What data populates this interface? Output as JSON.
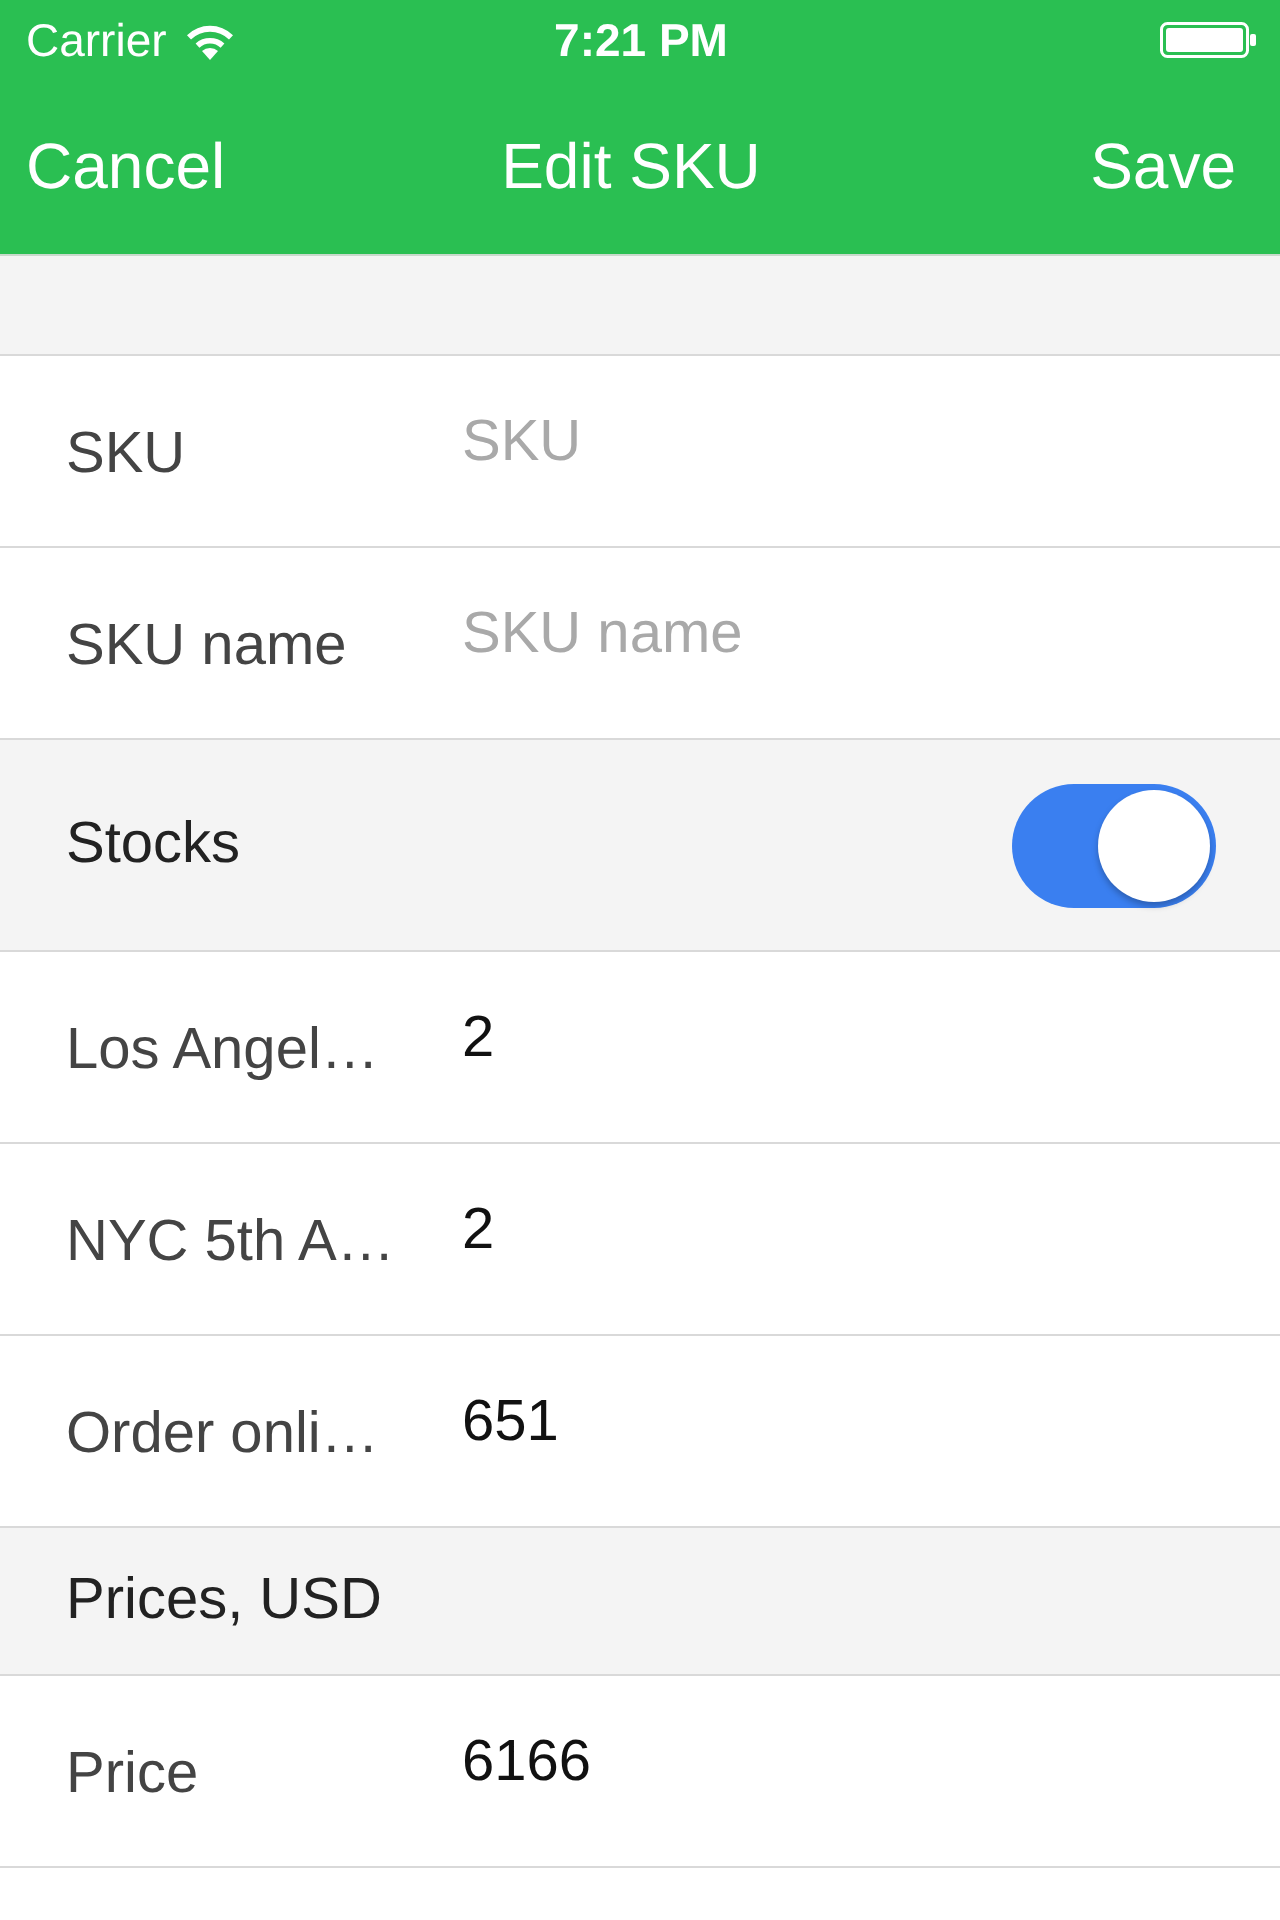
{
  "status_bar": {
    "carrier": "Carrier",
    "time": "7:21 PM"
  },
  "nav_bar": {
    "left_button": "Cancel",
    "title": "Edit SKU",
    "right_button": "Save"
  },
  "rows": [
    {
      "kind": "field",
      "label": "SKU",
      "placeholder": "SKU"
    },
    {
      "kind": "field",
      "label": "SKU name",
      "placeholder": "SKU name"
    },
    {
      "kind": "section",
      "label": "Stocks",
      "toggle": {
        "on": true
      }
    },
    {
      "kind": "field",
      "label": "Los Angel…",
      "value": "2"
    },
    {
      "kind": "field",
      "label": "NYC 5th A…",
      "value": "2"
    },
    {
      "kind": "field",
      "label": "Order onli…",
      "value": "651"
    },
    {
      "kind": "section",
      "label": "Prices, USD"
    },
    {
      "kind": "field",
      "label": "Price",
      "value": "6166"
    }
  ]
}
